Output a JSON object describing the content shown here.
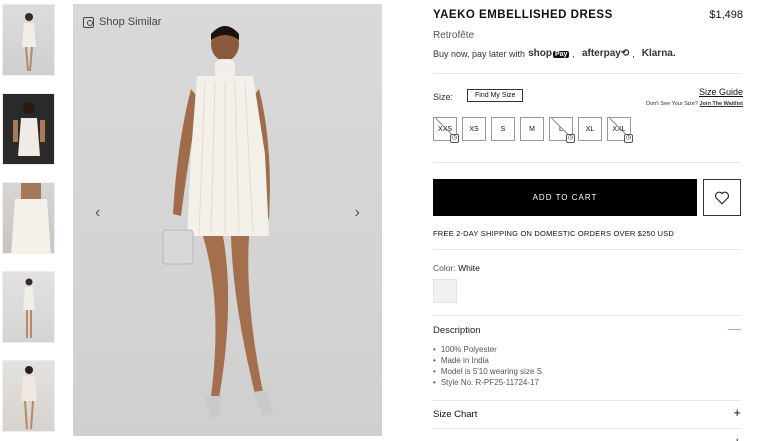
{
  "gallery": {
    "shop_similar_label": "Shop Similar",
    "prev_arrow": "‹",
    "next_arrow": "›",
    "thumbnail_count": 5
  },
  "product": {
    "title": "YAEKO EMBELLISHED DRESS",
    "price": "$1,498",
    "brand": "Retrofête",
    "pay_later_text": "Buy now, pay later with",
    "pay_shop": "shop",
    "pay_pay": "Pay",
    "pay_afterpay": "afterpay⟲",
    "pay_klarna": "Klarna.",
    "sep1": ",",
    "sep2": ","
  },
  "size": {
    "label": "Size:",
    "find_my_size": "Find My Size",
    "size_guide": "Size Guide",
    "waitlist_prefix": "Don't See Your Size?",
    "waitlist_link": "Join The Waitlist",
    "options": [
      {
        "label": "XXS",
        "available": false
      },
      {
        "label": "XS",
        "available": true
      },
      {
        "label": "S",
        "available": true
      },
      {
        "label": "M",
        "available": true
      },
      {
        "label": "L",
        "available": false
      },
      {
        "label": "XL",
        "available": true
      },
      {
        "label": "XXL",
        "available": false
      }
    ]
  },
  "cart": {
    "add_to_cart": "ADD TO CART",
    "shipping_note": "FREE 2-DAY SHIPPING ON DOMESTIC ORDERS OVER $250 USD"
  },
  "color": {
    "label": "Color:",
    "value": "White",
    "swatch": "#f1f1f1"
  },
  "description": {
    "heading": "Description",
    "toggle": "—",
    "items": [
      "100% Polyester",
      "Made in India",
      "Model is 5'10 wearing size S",
      "Style No. R-PF25-11724-17"
    ]
  },
  "size_chart": {
    "heading": "Size Chart",
    "toggle": "+"
  },
  "next_section": {
    "toggle": "+"
  },
  "colors": {
    "accent": "#000000",
    "description_toggle": "#c9a27a"
  }
}
